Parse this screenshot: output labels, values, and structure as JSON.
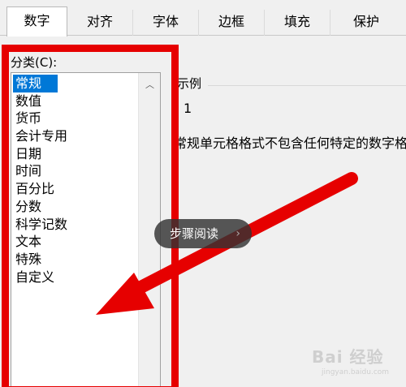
{
  "tabs": [
    {
      "label": "数字",
      "active": true
    },
    {
      "label": "对齐"
    },
    {
      "label": "字体"
    },
    {
      "label": "边框"
    },
    {
      "label": "填充"
    },
    {
      "label": "保护"
    }
  ],
  "category": {
    "label": "分类(C):",
    "items": [
      "常规",
      "数值",
      "货币",
      "会计专用",
      "日期",
      "时间",
      "百分比",
      "分数",
      "科学记数",
      "文本",
      "特殊",
      "自定义"
    ],
    "selected_index": 0
  },
  "sample": {
    "label": "示例",
    "value": "1"
  },
  "description": "常规单元格格式不包含任何特定的数字格式。",
  "pill": {
    "label": "步骤阅读",
    "chevron": "›"
  },
  "watermark": {
    "main": "Bai 经验",
    "sub": "jingyan.baidu.com"
  },
  "colors": {
    "highlight": "#e60000",
    "selection": "#0078d7"
  }
}
